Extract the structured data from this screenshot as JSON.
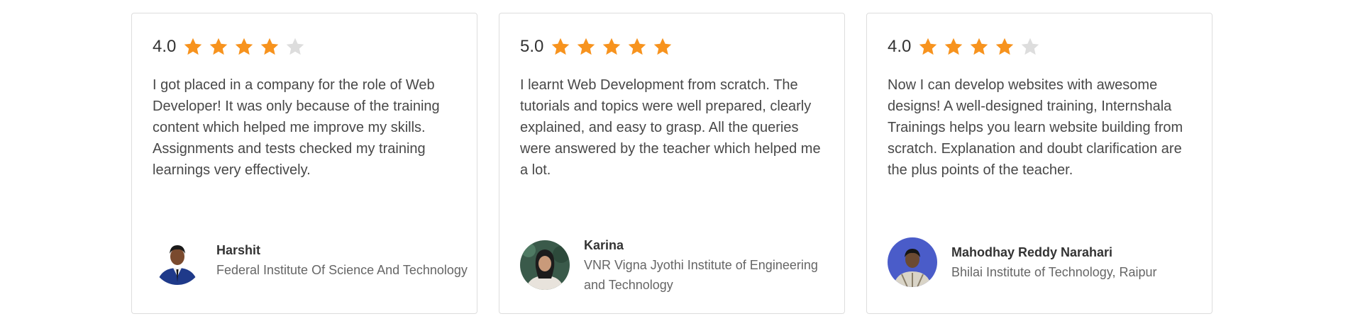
{
  "reviews": [
    {
      "rating": "4.0",
      "stars_filled": 4,
      "stars_total": 5,
      "text": "I got placed in a company for the role of Web Developer! It was only because of the training content which helped me improve my skills. Assignments and tests checked my training learnings very effectively.",
      "name": "Harshit",
      "college": "Federal Institute Of Science And Technology"
    },
    {
      "rating": "5.0",
      "stars_filled": 5,
      "stars_total": 5,
      "text": "I learnt Web Development from scratch. The tutorials and topics were well prepared, clearly explained, and easy to grasp. All the queries were answered by the teacher which helped me a lot.",
      "name": "Karina",
      "college": "VNR Vigna Jyothi Institute of Engineering and Technology"
    },
    {
      "rating": "4.0",
      "stars_filled": 4,
      "stars_total": 5,
      "text": "Now I can develop websites with awesome designs! A well-designed training, Internshala Trainings helps you learn website building from scratch. Explanation and doubt clarification are the plus points of the teacher.",
      "name": "Mahodhay Reddy Narahari",
      "college": "Bhilai Institute of Technology, Raipur"
    }
  ],
  "colors": {
    "star_filled": "#F7931E",
    "star_empty": "#DDDDDD",
    "card_border": "#DDDDDD"
  }
}
